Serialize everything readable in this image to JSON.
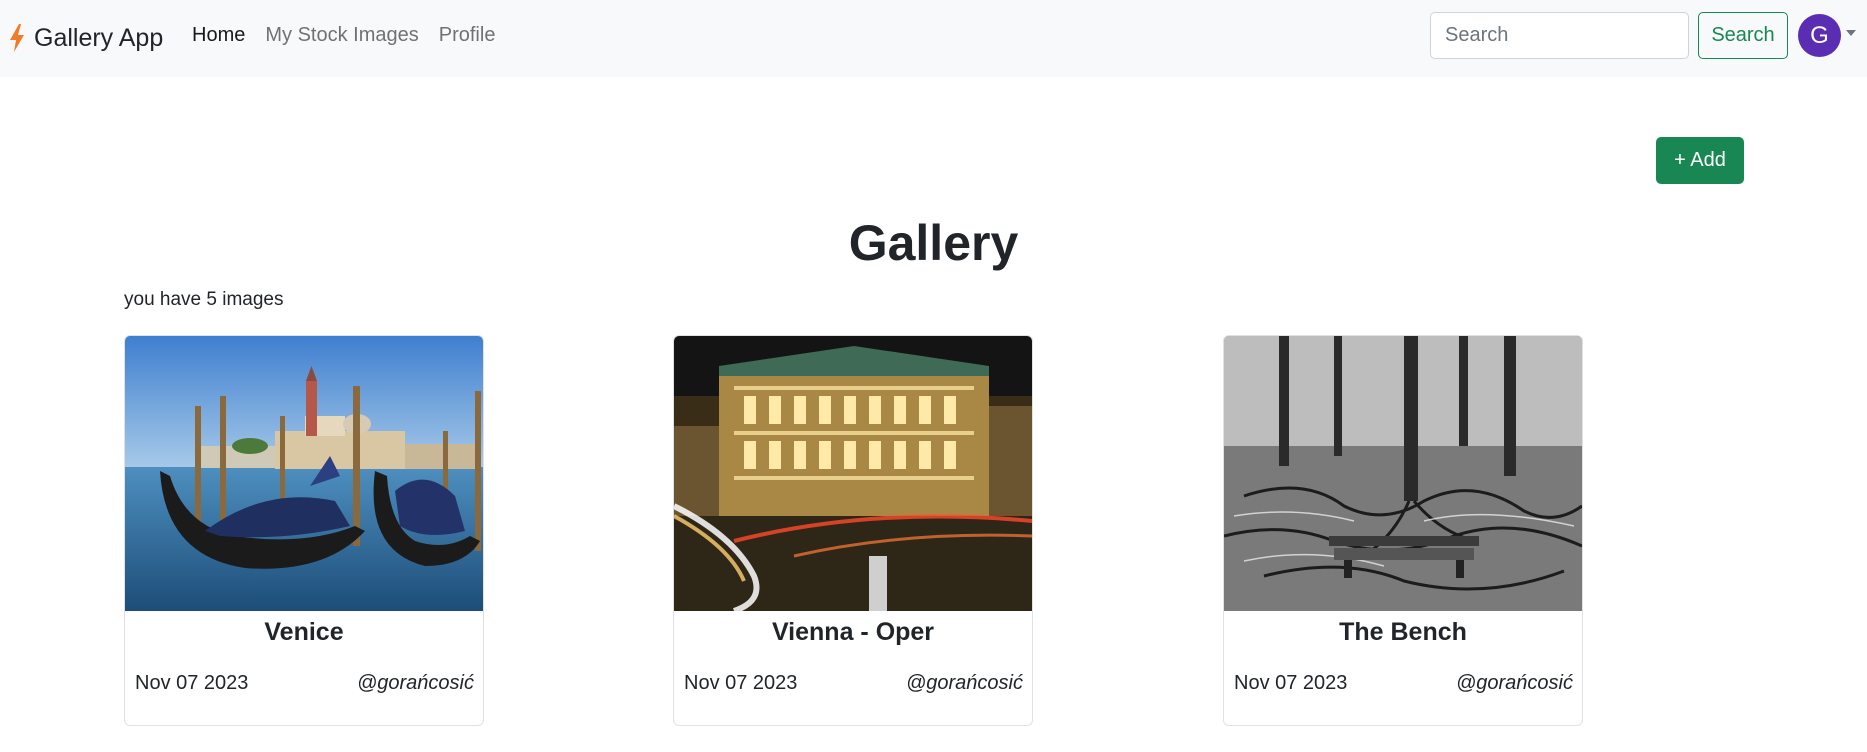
{
  "navbar": {
    "brand": "Gallery App",
    "brand_icon": "lightning-icon",
    "links": [
      {
        "label": "Home",
        "active": true
      },
      {
        "label": "My Stock Images",
        "active": false
      },
      {
        "label": "Profile",
        "active": false
      }
    ],
    "search_placeholder": "Search",
    "search_button": "Search",
    "avatar_initial": "G",
    "avatar_color": "#5b2db3"
  },
  "main": {
    "add_button": "+ Add",
    "title": "Gallery",
    "image_count_text": "you have 5 images"
  },
  "cards": [
    {
      "title": "Venice",
      "date": "Nov 07 2023",
      "author": "@gorańcosić",
      "image": "venice-gondolas-photo"
    },
    {
      "title": "Vienna - Oper",
      "date": "Nov 07 2023",
      "author": "@gorańcosić",
      "image": "vienna-opera-night-photo"
    },
    {
      "title": "The Bench",
      "date": "Nov 07 2023",
      "author": "@gorańcosić",
      "image": "forest-bench-bw-photo"
    }
  ],
  "colors": {
    "accent_green": "#198754",
    "navbar_bg": "#f8f9fa",
    "brand_icon": "#f07c2b"
  }
}
